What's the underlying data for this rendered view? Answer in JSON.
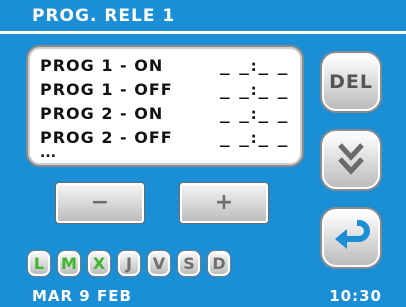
{
  "header": {
    "title": "PROG. RELE 1"
  },
  "programs": [
    {
      "label": "PROG 1 - ON",
      "time": "_ _:_ _"
    },
    {
      "label": "PROG 1 - OFF",
      "time": "_ _:_ _"
    },
    {
      "label": "PROG 2 - ON",
      "time": "_ _:_ _"
    },
    {
      "label": "PROG 2 - OFF",
      "time": "_ _:_ _"
    }
  ],
  "more_indicator": "...",
  "controls": {
    "minus_label": "−",
    "plus_label": "+",
    "del_label": "DEL",
    "down_icon": "double-chevron-down-icon",
    "enter_icon": "return-arrow-icon"
  },
  "days": [
    {
      "label": "L",
      "active": true
    },
    {
      "label": "M",
      "active": true
    },
    {
      "label": "X",
      "active": true
    },
    {
      "label": "J",
      "active": false
    },
    {
      "label": "V",
      "active": false
    },
    {
      "label": "S",
      "active": false
    },
    {
      "label": "D",
      "active": false
    }
  ],
  "footer": {
    "date": "MAR 9 FEB",
    "time": "10:30"
  },
  "colors": {
    "background": "#1a8fd6",
    "active_day": "#3fb52f",
    "inactive_day": "#6f6f6f",
    "enter_arrow": "#1a8fd6"
  }
}
